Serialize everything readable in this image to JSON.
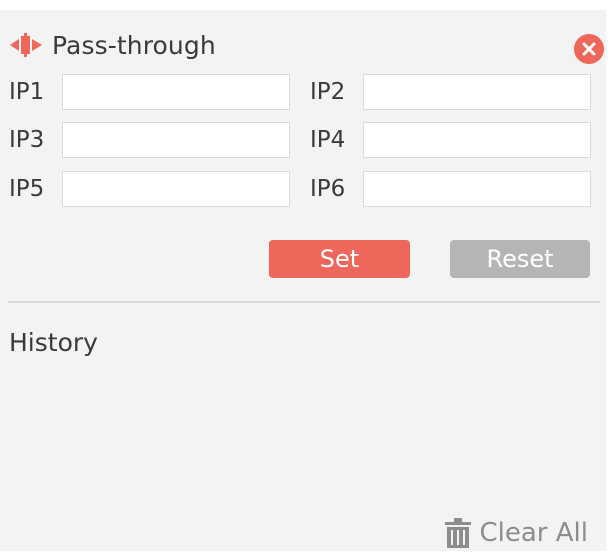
{
  "header": {
    "title": "Pass-through",
    "icon": "pass-through-icon",
    "close_icon": "close-icon"
  },
  "fields": [
    {
      "label": "IP1",
      "value": "",
      "placeholder": ""
    },
    {
      "label": "IP2",
      "value": "",
      "placeholder": ""
    },
    {
      "label": "IP3",
      "value": "",
      "placeholder": ""
    },
    {
      "label": "IP4",
      "value": "",
      "placeholder": ""
    },
    {
      "label": "IP5",
      "value": "",
      "placeholder": ""
    },
    {
      "label": "IP6",
      "value": "",
      "placeholder": ""
    }
  ],
  "actions": {
    "set_label": "Set",
    "reset_label": "Reset"
  },
  "history": {
    "label": "History",
    "clear_all_label": "Clear All",
    "clear_icon": "trash-icon"
  },
  "colors": {
    "accent": "#ef675b",
    "reset": "#b5b5b5",
    "panel_bg": "#f3f3f3"
  }
}
